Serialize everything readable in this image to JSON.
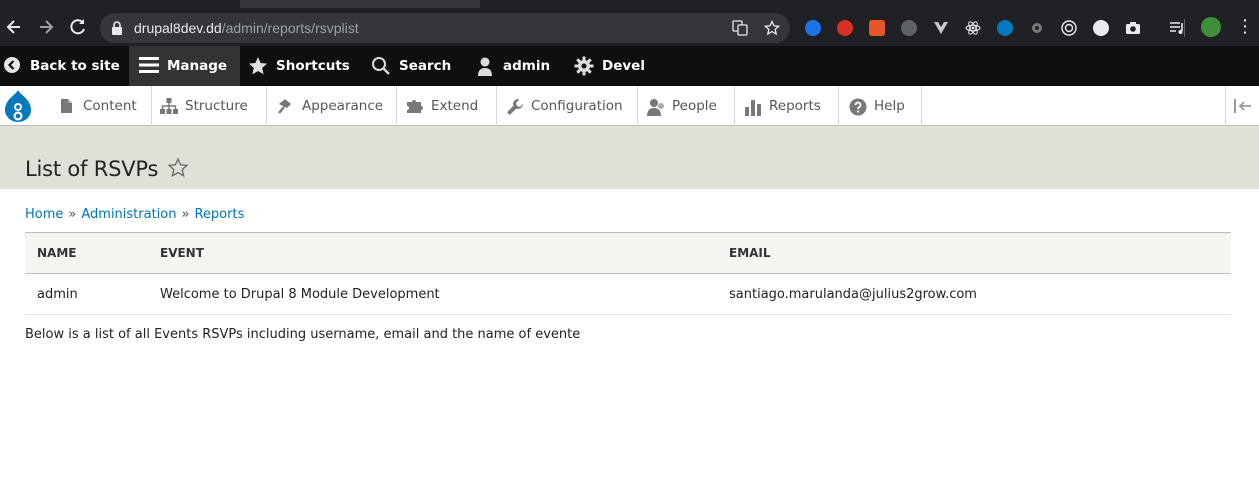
{
  "browser": {
    "url_host": "drupal8dev.dd",
    "url_path": "/admin/reports/rsvplist"
  },
  "toolbar": {
    "back_to_site": "Back to site",
    "manage": "Manage",
    "shortcuts": "Shortcuts",
    "search": "Search",
    "user": "admin",
    "devel": "Devel"
  },
  "tray": {
    "items": [
      {
        "label": "Content",
        "icon": "content-icon"
      },
      {
        "label": "Structure",
        "icon": "structure-icon"
      },
      {
        "label": "Appearance",
        "icon": "appearance-icon"
      },
      {
        "label": "Extend",
        "icon": "extend-icon"
      },
      {
        "label": "Configuration",
        "icon": "configuration-icon"
      },
      {
        "label": "People",
        "icon": "people-icon"
      },
      {
        "label": "Reports",
        "icon": "reports-icon"
      },
      {
        "label": "Help",
        "icon": "help-icon"
      }
    ]
  },
  "page": {
    "title": "List of RSVPs",
    "breadcrumb": [
      "Home",
      "Administration",
      "Reports"
    ],
    "breadcrumb_separator": "»",
    "description": "Below is a list of all Events RSVPs including username, email and the name of evente"
  },
  "table": {
    "headers": [
      "Name",
      "Event",
      "Email"
    ],
    "rows": [
      [
        "admin",
        "Welcome to Drupal 8 Module Development",
        "santiago.marulanda@julius2grow.com"
      ]
    ]
  },
  "colors": {
    "link": "#0074bd",
    "toolbar_bg": "#0f0f0f",
    "header_bg": "#e0e0d8",
    "drupal_blue": "#0678be"
  }
}
